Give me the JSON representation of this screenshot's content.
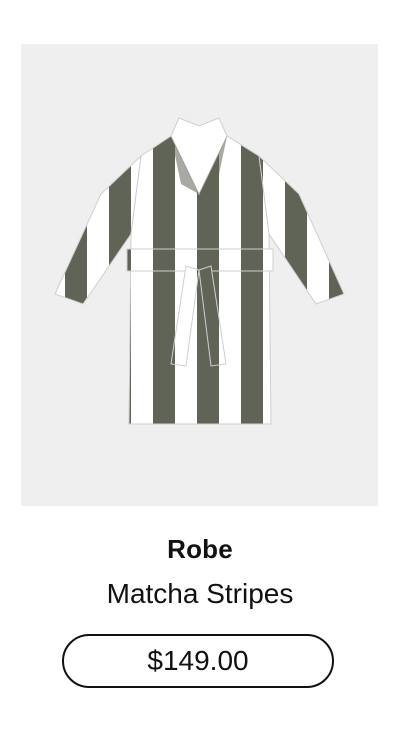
{
  "product": {
    "image_icon": "striped-robe-image",
    "name": "Robe",
    "variant": "Matcha Stripes",
    "price": "$149.00",
    "colors": {
      "stripe_dark": "#5f6456",
      "stripe_light": "#ffffff",
      "background": "#efefef"
    }
  }
}
